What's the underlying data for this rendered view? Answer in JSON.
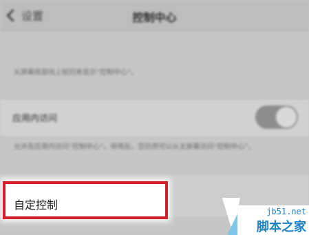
{
  "nav": {
    "back_label": "设置",
    "title": "控制中心"
  },
  "lockscreen": {
    "description": "从屏幕底部向上轻扫来显示“控制中心”。"
  },
  "in_app": {
    "label": "应用内访问",
    "toggle_on": true,
    "description": "允许在应用内访问“控制中心”。停用后，您仍然可以从主屏幕访问“控制中心”。"
  },
  "customize": {
    "label": "自定控制"
  },
  "watermark": {
    "url": "jb51.net",
    "name": "脚本之家"
  }
}
